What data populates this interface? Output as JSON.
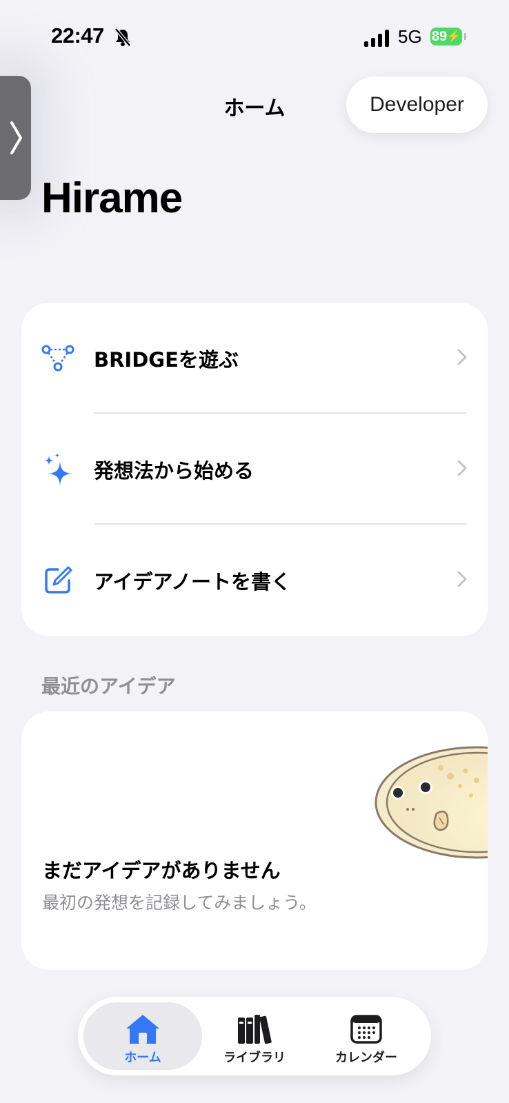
{
  "status_bar": {
    "time": "22:47",
    "network": "5G",
    "battery": "89"
  },
  "nav": {
    "title": "ホーム",
    "developer_button": "Developer"
  },
  "page": {
    "title": "Hirame"
  },
  "menu": {
    "items": [
      {
        "label": "BRIDGEを遊ぶ",
        "icon": "bridge-nodes-icon"
      },
      {
        "label": "発想法から始める",
        "icon": "sparkles-icon"
      },
      {
        "label": "アイデアノートを書く",
        "icon": "compose-icon"
      }
    ]
  },
  "recent": {
    "header": "最近のアイデア",
    "empty_title": "まだアイデアがありません",
    "empty_subtitle": "最初の発想を記録してみましょう。"
  },
  "tabbar": {
    "tabs": [
      {
        "label": "ホーム",
        "icon": "house-icon",
        "active": true
      },
      {
        "label": "ライブラリ",
        "icon": "books-icon",
        "active": false
      },
      {
        "label": "カレンダー",
        "icon": "calendar-icon",
        "active": false
      }
    ]
  },
  "colors": {
    "accent": "#3478f6",
    "background": "#f2f2f7",
    "secondary_text": "#8e8e93",
    "battery": "#4cd964"
  }
}
